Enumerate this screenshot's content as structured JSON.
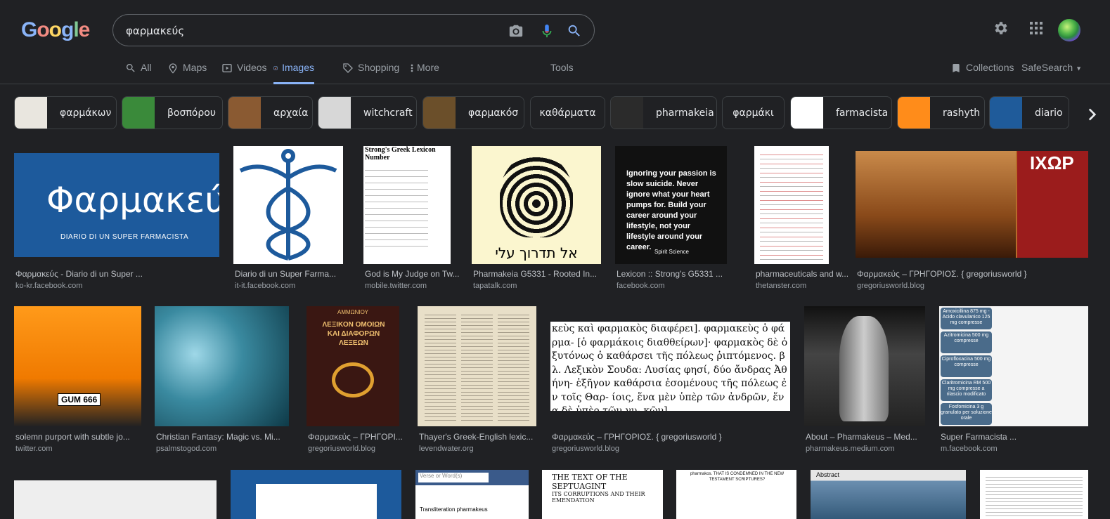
{
  "logo": {
    "letters": [
      "G",
      "o",
      "o",
      "g",
      "l",
      "e"
    ],
    "colors": [
      "#8ab4f8",
      "#f28b82",
      "#fdd663",
      "#8ab4f8",
      "#81c995",
      "#f28b82"
    ]
  },
  "search": {
    "query": "φαρμακεύς"
  },
  "tabs": [
    {
      "label": "All",
      "icon": "search-icon"
    },
    {
      "label": "Maps",
      "icon": "map-pin-icon"
    },
    {
      "label": "Videos",
      "icon": "video-icon"
    },
    {
      "label": "Images",
      "icon": "image-icon",
      "active": true
    },
    {
      "label": "Shopping",
      "icon": "tag-icon"
    },
    {
      "label": "More",
      "icon": "more-vertical-icon"
    }
  ],
  "tools_label": "Tools",
  "collections_label": "Collections",
  "safesearch_label": "SafeSearch",
  "chips": [
    {
      "label": "φαρμάκων"
    },
    {
      "label": "βοσπόρου"
    },
    {
      "label": "αρχαία"
    },
    {
      "label": "witchcraft"
    },
    {
      "label": "φαρμακόσ"
    },
    {
      "label": "καθάρματα"
    },
    {
      "label": "pharmakeia"
    },
    {
      "label": "φαρμάκι"
    },
    {
      "label": "farmacista"
    },
    {
      "label": "rashyth"
    },
    {
      "label": "diario"
    }
  ],
  "results_row1": [
    {
      "title": "Φαρμακεύς - Diario di un Super ...",
      "source": "ko-kr.facebook.com",
      "img_text": "Φαρμακεύς",
      "img_subtext": "DIARIO DI UN SUPER FARMACISTA"
    },
    {
      "title": "Diario di un Super Farma...",
      "source": "it-it.facebook.com"
    },
    {
      "title": "God is My Judge on Tw...",
      "source": "mobile.twitter.com",
      "img_text": "Strong's Greek Lexicon Number"
    },
    {
      "title": "Pharmakeia G5331 - Rooted In...",
      "source": "tapatalk.com",
      "img_text": "אל תדרוך עלי"
    },
    {
      "title": "Lexicon :: Strong's G5331 ...",
      "source": "facebook.com",
      "img_text": "Ignoring your passion is slow suicide. Never ignore what your heart pumps for. Build your career around your lifestyle, not your lifestyle around your career.",
      "img_subtext": "Spirit Science"
    },
    {
      "title": "pharmaceuticals and w...",
      "source": "thetanster.com"
    },
    {
      "title": "Φαρμακεύς – ΓΡΗΓΟΡΙΟΣ. { gregoriusworld }",
      "source": "gregoriusworld.blog",
      "img_text": "ΙΧΩΡ"
    }
  ],
  "results_row2": [
    {
      "title": "solemn purport with subtle jo...",
      "source": "twitter.com",
      "img_text": "GUM 666"
    },
    {
      "title": "Christian Fantasy: Magic vs. Mi...",
      "source": "psalmstogod.com"
    },
    {
      "title": "Φαρμακεύς – ΓΡΗΓΟΡΙ...",
      "source": "gregoriusworld.blog",
      "img_text": "ΛΕΞΙΚΟΝ ΟΜΟΙΩΝ ΚΑΙ ΔΙΑΦΟΡΩΝ ΛΕΞΕΩΝ",
      "img_subtext": "ΑΜΜΩΝΙΟΥ"
    },
    {
      "title": "Thayer's Greek-English lexic...",
      "source": "levendwater.org"
    },
    {
      "title": "Φαρμακεύς – ΓΡΗΓΟΡΙΟΣ. { gregoriusworld }",
      "source": "gregoriusworld.blog",
      "img_text": "κεὺς καὶ φαρμακὸς διαφέρει]. φαρμακεὺς ὁ φάρμα- [ὁ φαρμάκοις διαθθείρων]· φαρμακὸς δὲ ὀξυτόνως ὁ καθάρσει τῆς πόλεως ῥιπτόμενος. βλ. Λεξικὸν Σουδα: Λυσίας φησί, δύο ἄνδρας Ἀθήνη- ἐξῆγον καθάρσια ἐσομένους τῆς πόλεως ἐν τοῖς Θαρ- ίοις, ἕνα μὲν ὑπὲρ τῶν ἀνδρῶν, ἕνα δὲ ὑπὲρ τῶν γυ- κῶν]."
    },
    {
      "title": "About – Pharmakeus – Med...",
      "source": "pharmakeus.medium.com"
    },
    {
      "title": "Super Farmacista ...",
      "source": "m.facebook.com",
      "img_items": [
        "Amoxicillina 875 mg - Acido clavulanico 125 mg compresse",
        "Azitromicina 500 mg compresse",
        "Ciprofloxacina 500 mg compresse",
        "Claritromicina RM 500 mg compresse a rilascio modificato",
        "Fosfomicina 3 g granulato per soluzione orale"
      ]
    }
  ],
  "results_row3": [
    {
      "img_text": ""
    },
    {
      "img_text": ""
    },
    {
      "img_text": "Verse or Word(s)",
      "img_subtext": "Transliteration pharmakeus"
    },
    {
      "img_text": "THE TEXT OF THE SEPTUAGINT",
      "img_subtext": "ITS CORRUPTIONS AND THEIR EMENDATION"
    },
    {
      "img_text": "pharmakos. THAT IS CONDEMNED IN THE NEW TESTAMENT SCRIPTURES?"
    },
    {
      "img_text": "Abstract"
    },
    {
      "img_text": ""
    }
  ]
}
